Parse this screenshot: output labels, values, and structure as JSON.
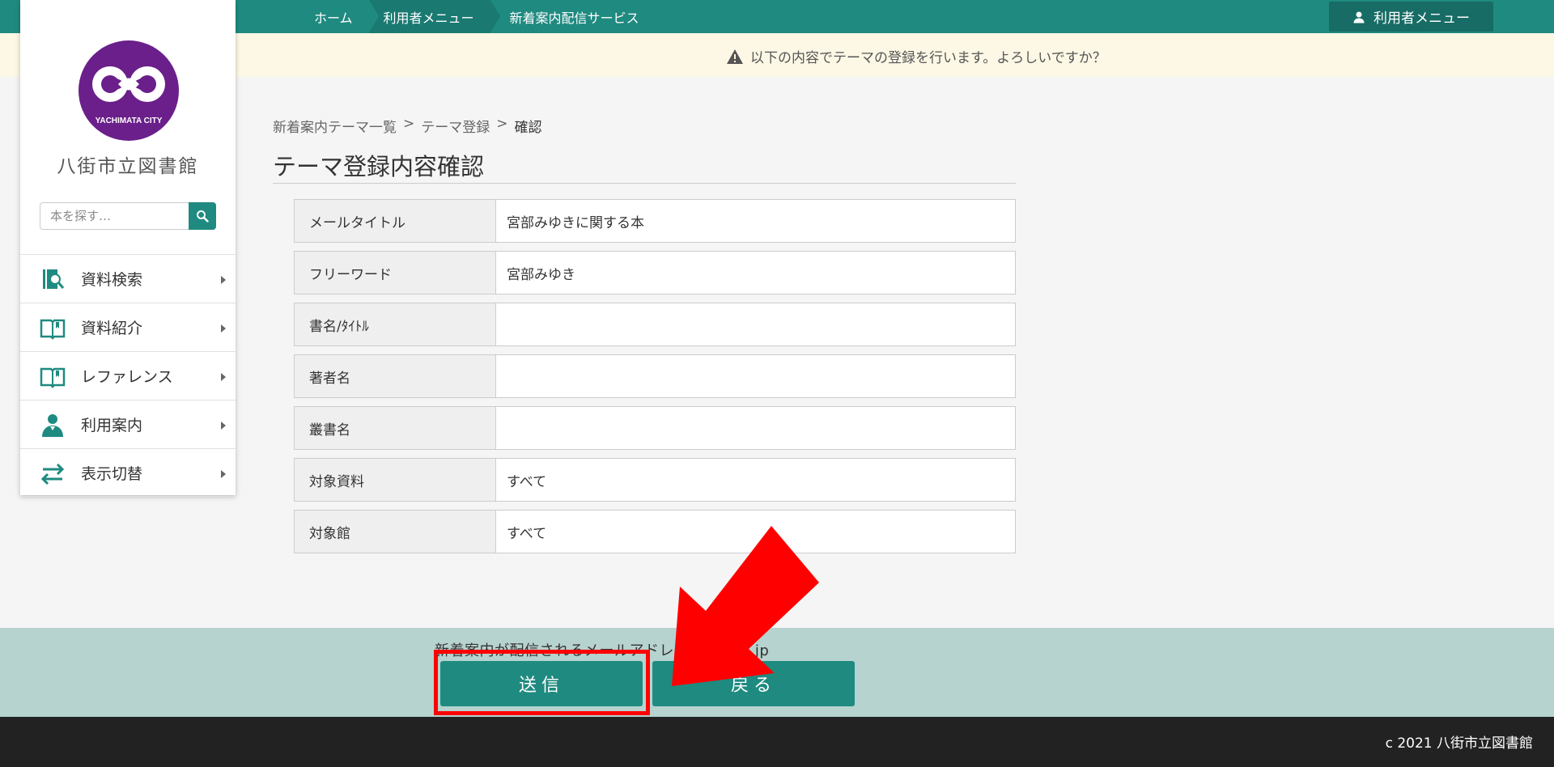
{
  "topbar": {
    "crumbs": [
      "ホーム",
      "利用者メニュー",
      "新着案内配信サービス"
    ],
    "user_menu_label": "利用者メニュー"
  },
  "alert": {
    "message": "以下の内容でテーマの登録を行います。よろしいですか？"
  },
  "sidebar": {
    "logo_text": "YACHIMATA CITY",
    "library_name": "八街市立図書館",
    "search_placeholder": "本を探す…",
    "items": [
      {
        "label": "資料検索",
        "icon": "book-search-icon"
      },
      {
        "label": "資料紹介",
        "icon": "open-book-icon"
      },
      {
        "label": "レファレンス",
        "icon": "open-book-icon"
      },
      {
        "label": "利用案内",
        "icon": "person-icon"
      },
      {
        "label": "表示切替",
        "icon": "swap-arrows-icon"
      }
    ]
  },
  "main": {
    "breadcrumb": [
      "新着案内テーマ一覧",
      "テーマ登録",
      "確認"
    ],
    "breadcrumb_sep": ">",
    "title": "テーマ登録内容確認",
    "rows": [
      {
        "label": "メールタイトル",
        "value": "宮部みゆきに関する本"
      },
      {
        "label": "フリーワード",
        "value": "宮部みゆき"
      },
      {
        "label": "書名/ﾀｲﾄﾙ",
        "value": ""
      },
      {
        "label": "著者名",
        "value": ""
      },
      {
        "label": "叢書名",
        "value": ""
      },
      {
        "label": "対象資料",
        "value": "すべて"
      },
      {
        "label": "対象館",
        "value": "すべて"
      }
    ]
  },
  "footer": {
    "email_note": "新着案内が配信されるメールアドレス：iii@co.jp",
    "send_label": "送信",
    "back_label": "戻る",
    "copyright": "c 2021 八街市立図書館"
  },
  "colors": {
    "primary": "#1f8a80",
    "alert_bg": "#fdf8e5",
    "footer_band": "#b6d3cf",
    "highlight": "#ff0000",
    "logo_purple": "#6a1f8a"
  }
}
